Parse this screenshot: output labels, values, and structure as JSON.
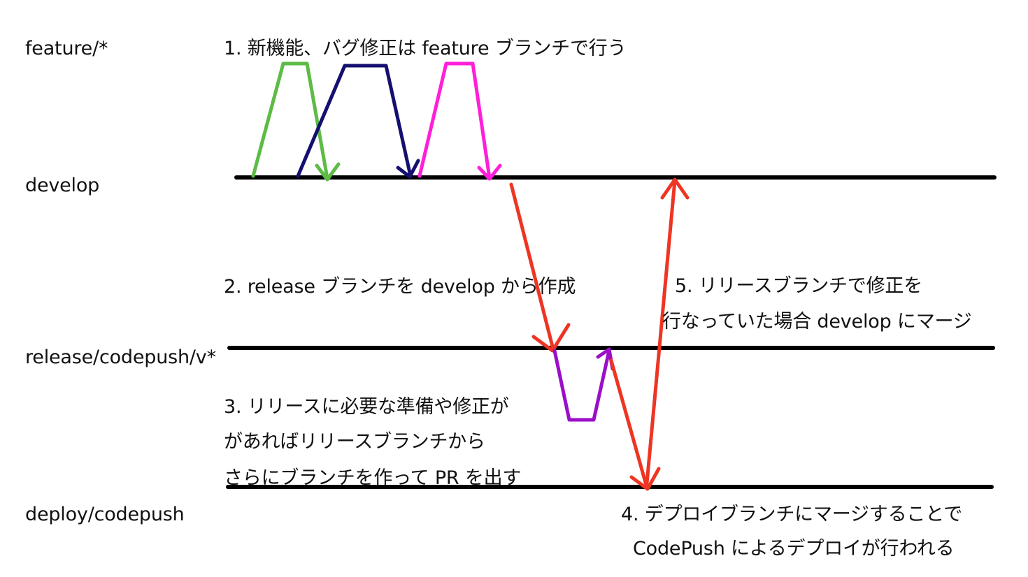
{
  "branches": {
    "feature": "feature/*",
    "develop": "develop",
    "release": "release/codepush/v*",
    "deploy": "deploy/codepush"
  },
  "notes": {
    "n1": [
      "1. 新機能、バグ修正は feature ブランチで行う"
    ],
    "n2": [
      "2. release ブランチを develop から作成"
    ],
    "n3": [
      "3. リリースに必要な準備や修正が",
      "があればリリースブランチから",
      "さらにブランチを作って PR を出す"
    ],
    "n4": [
      "4. デプロイブランチにマージすることで",
      "CodePush によるデプロイが行われる"
    ],
    "n5": [
      "5. リリースブランチで修正を",
      "行なっていた場合 develop にマージ"
    ]
  },
  "colors": {
    "line": "#000000",
    "feature_a": "#5dbb46",
    "feature_b": "#141070",
    "feature_c": "#ff1fd9",
    "release_fix": "#9b0fc8",
    "merge_arrow": "#ee3524",
    "text": "#111111"
  }
}
